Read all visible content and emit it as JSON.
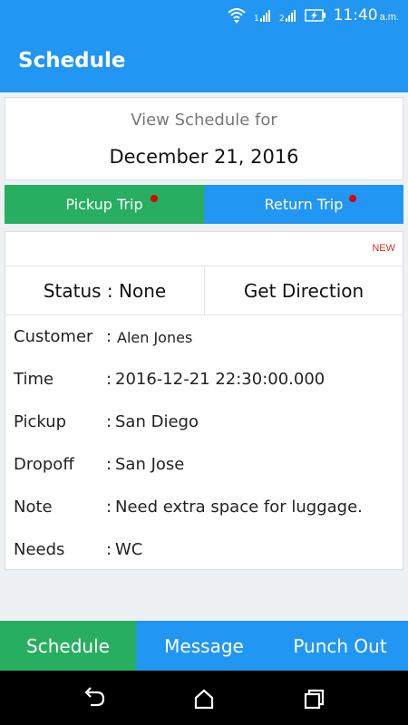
{
  "status_bar": {
    "time": "11:40",
    "ampm": "a.m.",
    "icons": [
      "wifi-icon",
      "signal-1-icon",
      "signal-2-icon",
      "battery-charging-icon"
    ]
  },
  "app_bar": {
    "title": "Schedule"
  },
  "schedule_header": {
    "label": "View Schedule for",
    "date": "December 21, 2016"
  },
  "trip_tabs": {
    "pickup": "Pickup Trip",
    "return": "Return Trip",
    "indicator_color": "#e00000"
  },
  "detail": {
    "badge": "NEW",
    "status": "Status : None",
    "get_direction": "Get Direction",
    "rows": [
      {
        "key": "Customer",
        "sep": ":",
        "value": "Alen Jones"
      },
      {
        "key": "Time",
        "sep": ":",
        "value": "2016-12-21 22:30:00.000"
      },
      {
        "key": "Pickup",
        "sep": ":",
        "value": "San Diego"
      },
      {
        "key": "Dropoff",
        "sep": ":",
        "value": "San Jose"
      },
      {
        "key": "Note",
        "sep": ":",
        "value": "Need extra space for luggage."
      },
      {
        "key": "Needs",
        "sep": ":",
        "value": "WC"
      }
    ]
  },
  "bottom_tabs": {
    "schedule": "Schedule",
    "message": "Message",
    "punch_out": "Punch Out",
    "active": "Schedule"
  },
  "colors": {
    "primary": "#2196f3",
    "green": "#27ae60",
    "badge_red": "#d32f2f"
  },
  "nav_bar": {
    "icons": [
      "back-icon",
      "home-icon",
      "recents-icon"
    ]
  }
}
